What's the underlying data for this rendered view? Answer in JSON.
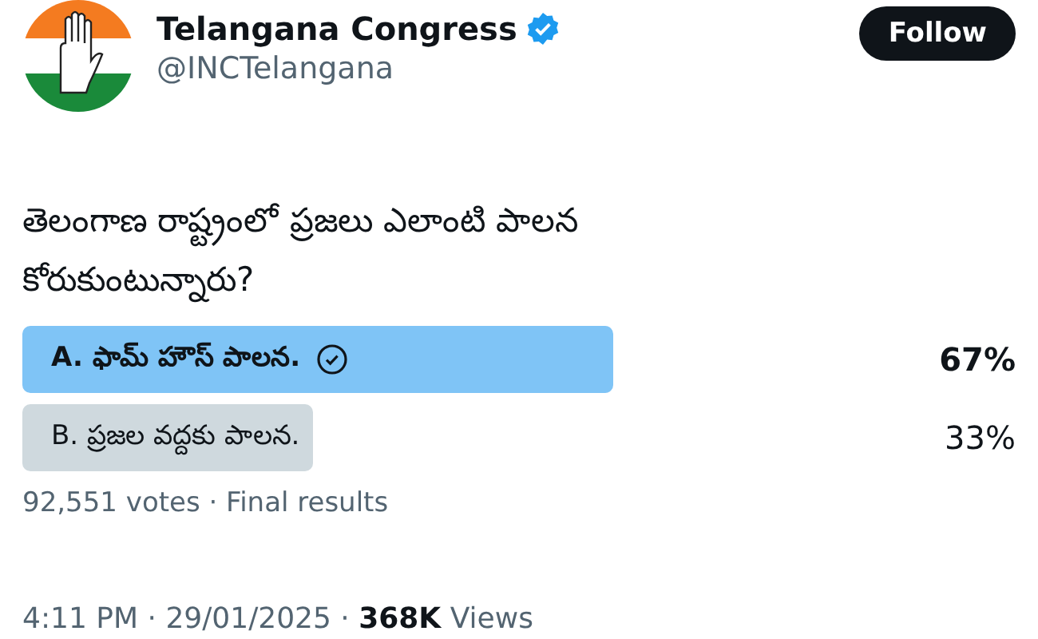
{
  "author": {
    "name": "Telangana Congress",
    "verified": true,
    "handle": "@INCTelangana"
  },
  "follow_button": "Follow",
  "question": "తెలంగాణ రాష్ట్రంలో ప్రజలు ఎలాంటి పాలన కోరుకుంటున్నారు?",
  "poll": {
    "options": [
      {
        "label": "A. ఫామ్ హౌస్ పాలన.",
        "percent": "67%",
        "selected": true
      },
      {
        "label": "B. ప్రజల వద్దకు పాలన.",
        "percent": "33%",
        "selected": false
      }
    ],
    "summary": "92,551 votes · Final results"
  },
  "meta": "4:11 PM · 29/01/2025 · **368K** Views"
}
